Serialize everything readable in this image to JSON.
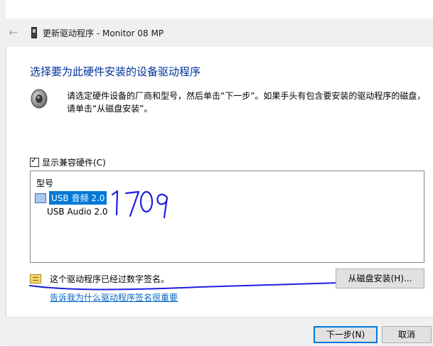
{
  "window": {
    "title": "更新驱动程序 - Monitor 08 MP"
  },
  "page": {
    "heading": "选择要为此硬件安装的设备驱动程序",
    "instruction": "请选定硬件设备的厂商和型号，然后单击“下一步”。如果手头有包含要安装的驱动程序的磁盘，请单击“从磁盘安装”。"
  },
  "compatible": {
    "label": "显示兼容硬件(C)",
    "checked": true
  },
  "list": {
    "header": "型号",
    "items": [
      {
        "label": "USB 音频 2.0",
        "selected": true
      },
      {
        "label": "USB Audio 2.0",
        "selected": false
      }
    ]
  },
  "handwriting": {
    "text": "1709",
    "color": "#1e1ee0"
  },
  "signature": {
    "text": "这个驱动程序已经过数字签名。",
    "link": "告诉我为什么驱动程序签名很重要"
  },
  "buttons": {
    "have_disk": "从磁盘安装(H)...",
    "next": "下一步(N)",
    "cancel": "取消"
  },
  "colors": {
    "heading": "#003399",
    "selection": "#0078d7",
    "link": "#0066cc"
  }
}
